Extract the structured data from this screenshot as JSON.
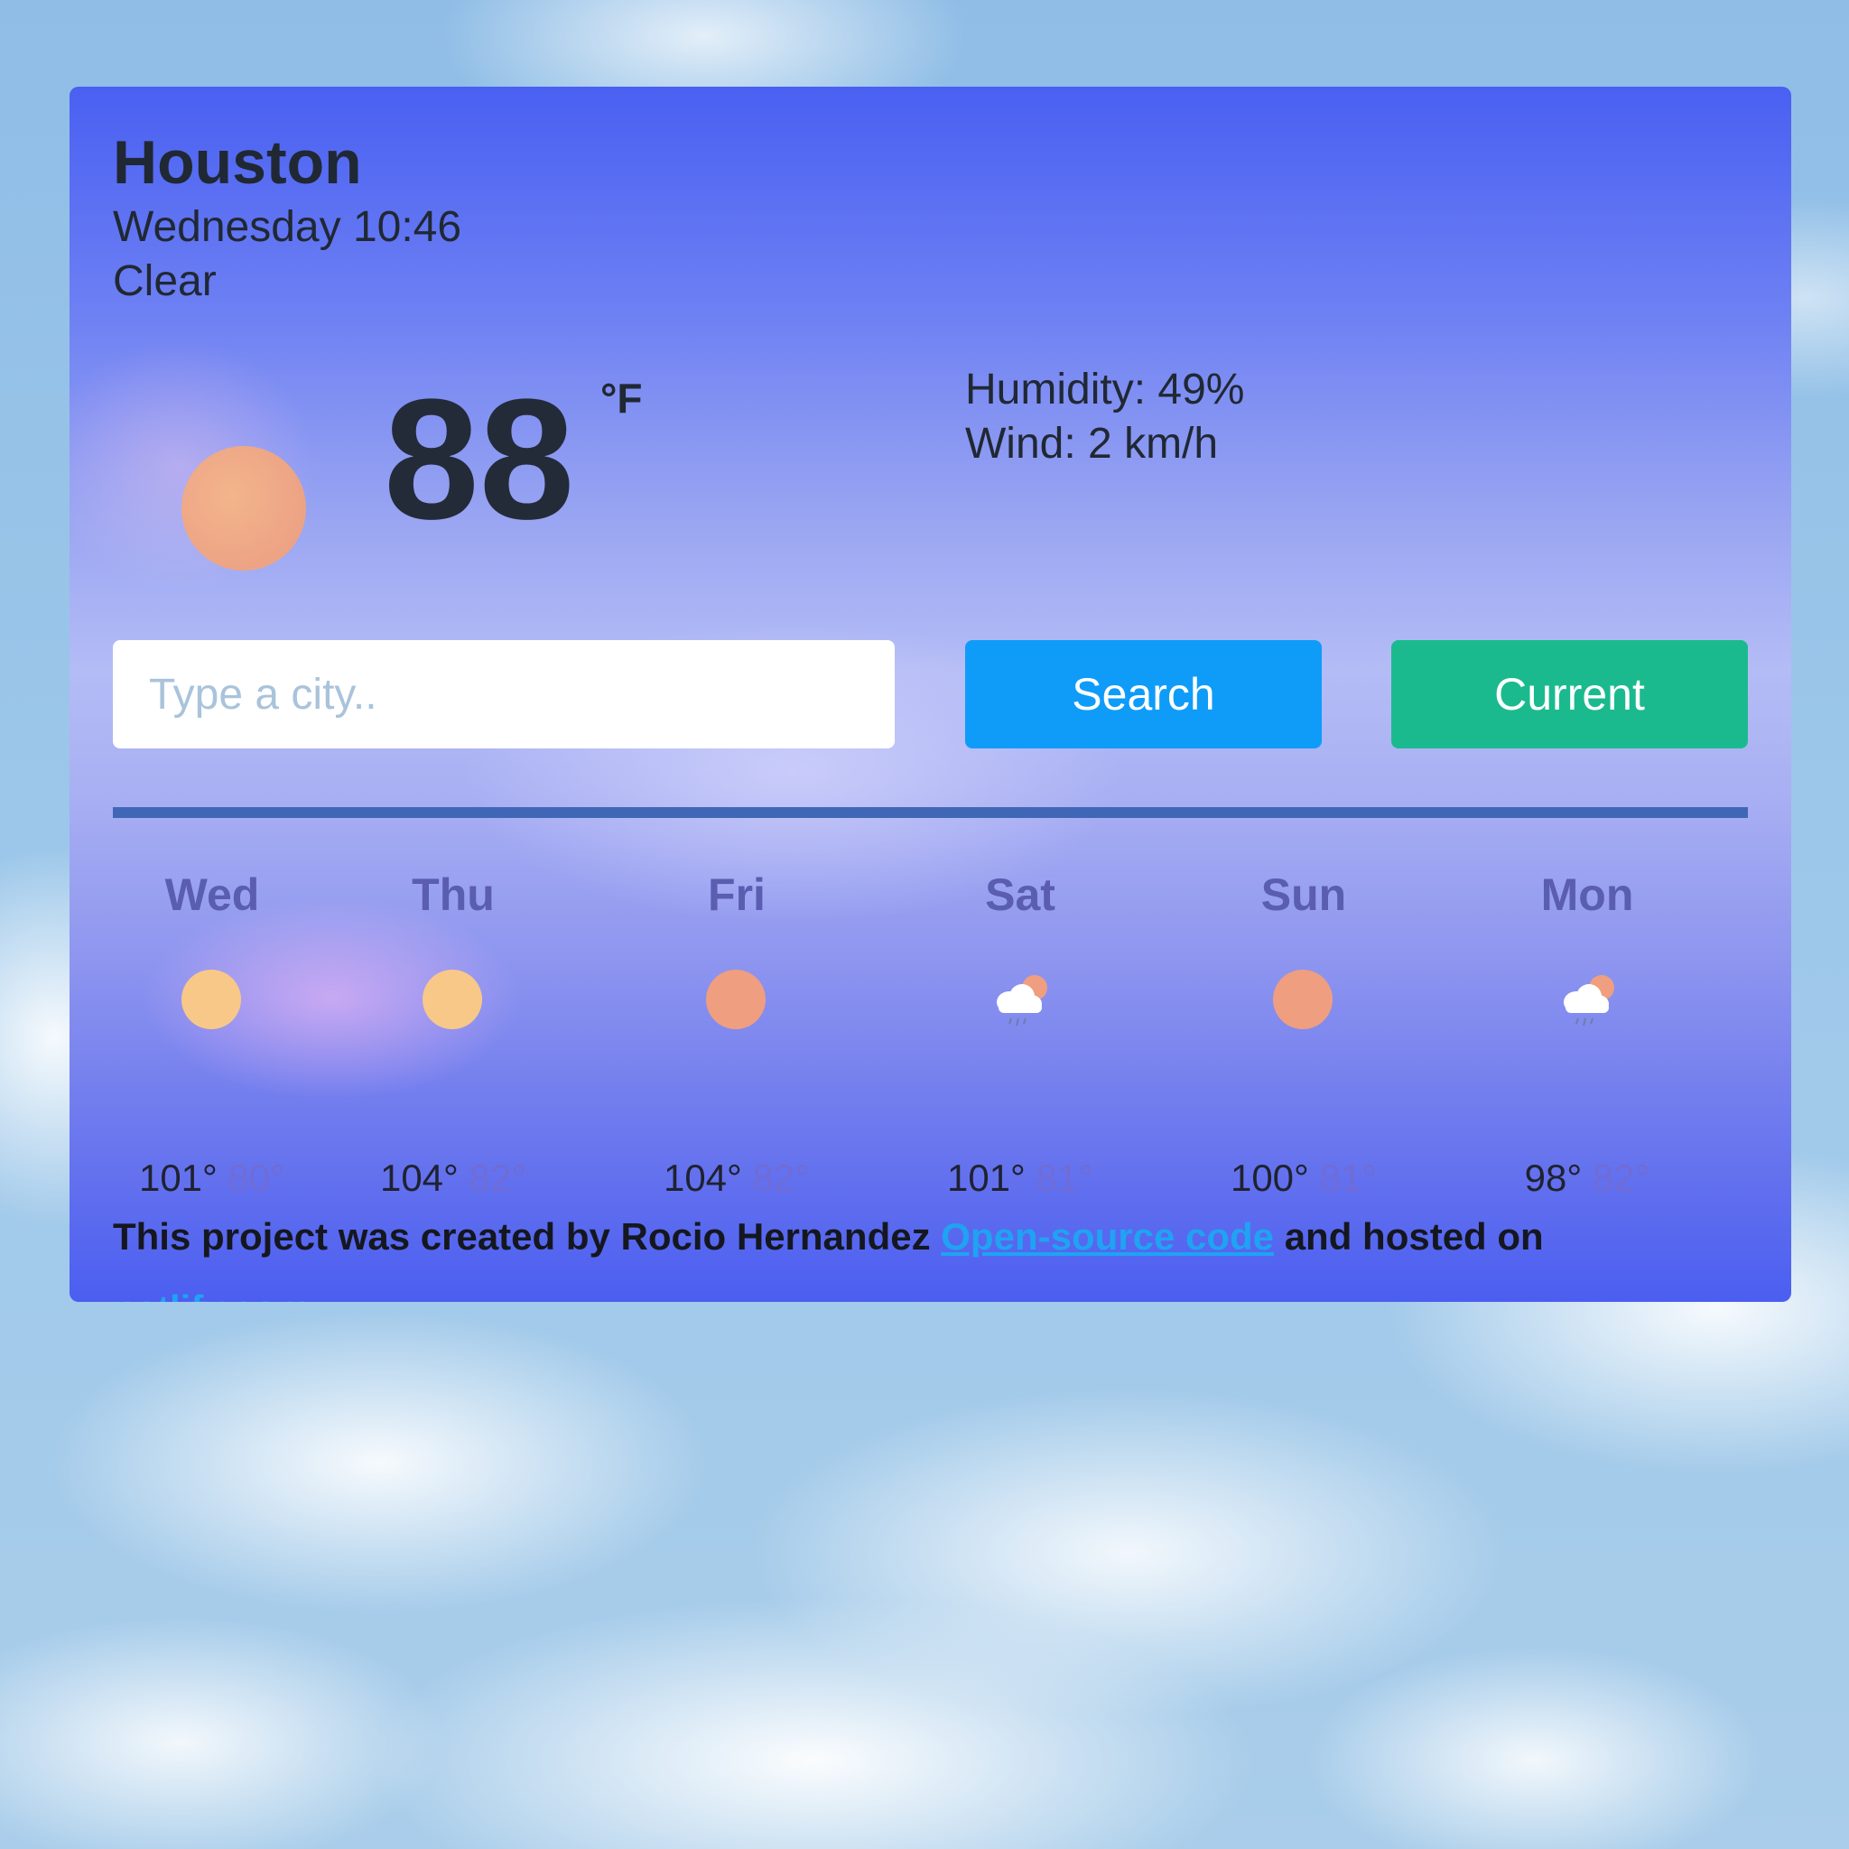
{
  "weather": {
    "city": "Houston",
    "datetime": "Wednesday 10:46",
    "condition": "Clear",
    "current_icon": "sun-icon",
    "temperature": "88",
    "unit": "°F",
    "humidity": "Humidity: 49%",
    "wind": "Wind: 2 km/h"
  },
  "search": {
    "placeholder": "Type a city..",
    "search_label": "Search",
    "current_label": "Current"
  },
  "forecast": [
    {
      "day": "Wed",
      "icon": "sun-icon",
      "max": "101°",
      "min": "80°"
    },
    {
      "day": "Thu",
      "icon": "sun-icon",
      "max": "104°",
      "min": "82°"
    },
    {
      "day": "Fri",
      "icon": "sun-icon",
      "max": "104°",
      "min": "82°"
    },
    {
      "day": "Sat",
      "icon": "rain-cloud-sun-icon",
      "max": "101°",
      "min": "81°"
    },
    {
      "day": "Sun",
      "icon": "sun-icon",
      "max": "100°",
      "min": "81°"
    },
    {
      "day": "Mon",
      "icon": "rain-cloud-sun-icon",
      "max": "98°",
      "min": "82°"
    }
  ],
  "footer": {
    "text_before": "This project was created by Rocio Hernandez ",
    "code_link": "Open-source code",
    "text_middle": " and hosted on ",
    "host_link": "netlify.com"
  },
  "colors": {
    "search_button": "#0f9cf9",
    "current_button": "#1bba8e",
    "link": "#1fa3f2",
    "divider": "#3f67b5"
  }
}
